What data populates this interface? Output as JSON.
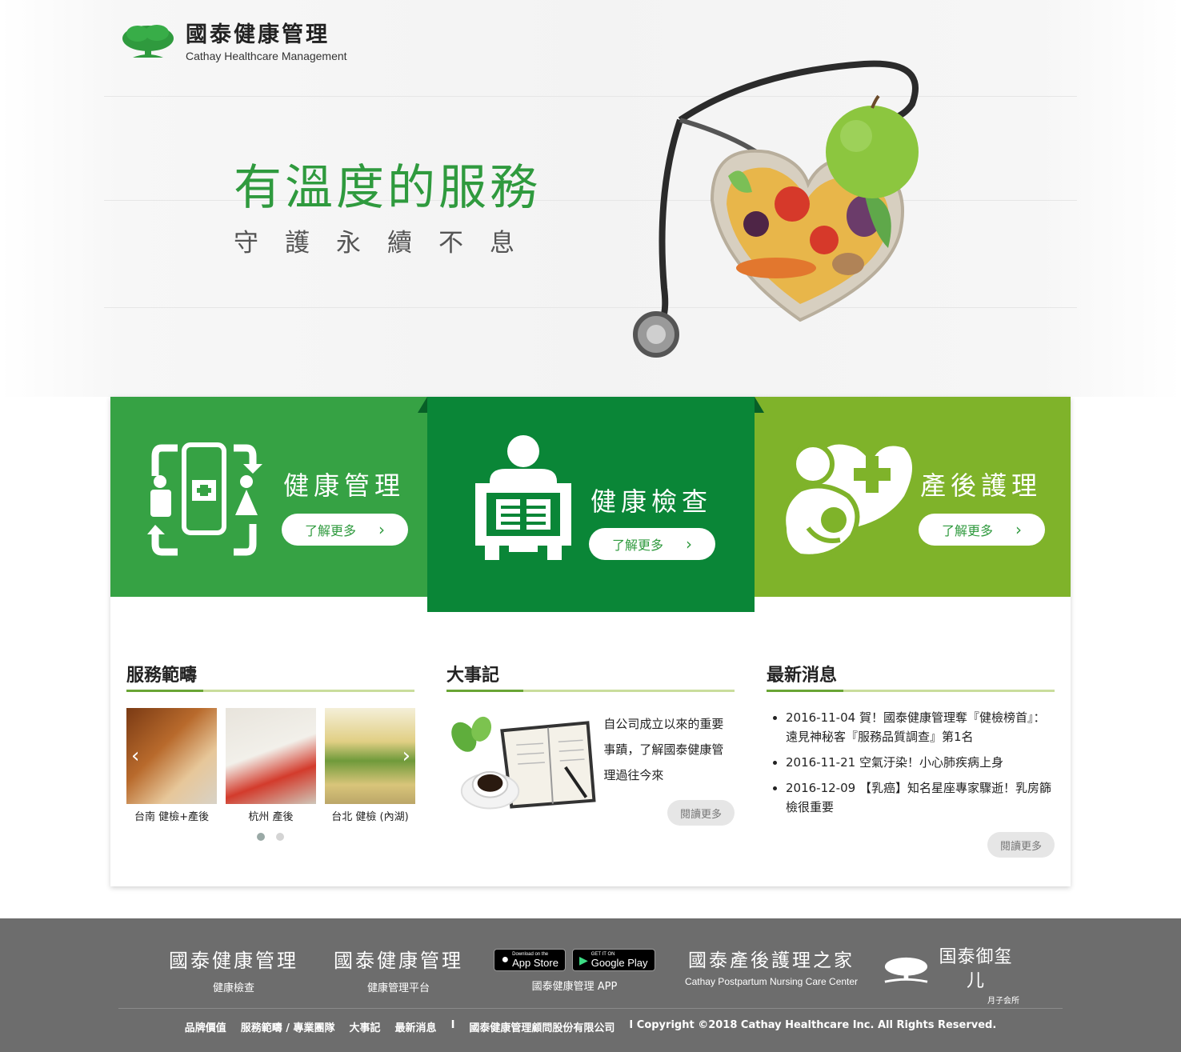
{
  "brand": {
    "name_zh": "國泰健康管理",
    "name_en": "Cathay Healthcare Management",
    "color_green": "#2f9a3e"
  },
  "hero": {
    "headline": "有溫度的服務",
    "subline": "守護永續不息"
  },
  "panels": [
    {
      "title": "健康管理",
      "more_label": "了解更多",
      "icon": "phone-health-icon",
      "color": "#36a244"
    },
    {
      "title": "健康檢查",
      "more_label": "了解更多",
      "icon": "xray-icon",
      "color": "#0a8637"
    },
    {
      "title": "產後護理",
      "more_label": "了解更多",
      "icon": "mother-baby-icon",
      "color": "#7fb32a"
    }
  ],
  "services": {
    "heading": "服務範疇",
    "items": [
      {
        "caption": "台南 健檢+產後"
      },
      {
        "caption": "杭州 產後"
      },
      {
        "caption": "台北 健檢 (內湖)"
      }
    ]
  },
  "events": {
    "heading": "大事記",
    "description": "自公司成立以來的重要事蹟，了解國泰健康管理過往今來",
    "read_more": "閱讀更多"
  },
  "news": {
    "heading": "最新消息",
    "items": [
      "2016-11-04 賀！國泰健康管理奪『健檢榜首』：遠見神秘客『服務品質調查』第1名",
      "2016-11-21 空氣汙染！小心肺疾病上身",
      "2016-12-09 【乳癌】知名星座專家驟逝！乳房篩檢很重要"
    ],
    "read_more": "閱讀更多"
  },
  "footer": {
    "brands": [
      {
        "title": "國泰健康管理",
        "sub": "健康檢查"
      },
      {
        "title": "國泰健康管理",
        "sub": "健康管理平台"
      },
      {
        "title": "國泰產後護理之家",
        "sub": "Cathay Postpartum Nursing Care Center"
      },
      {
        "title": "国泰御玺儿",
        "sub": "月子会所"
      }
    ],
    "app": {
      "appstore_small": "Download on the",
      "appstore_big": "App Store",
      "googleplay_small": "GET IT ON",
      "googleplay_big": "Google Play",
      "caption": "國泰健康管理 APP"
    },
    "links": [
      "品牌價值",
      "服務範疇 / 專業團隊",
      "大事記",
      "最新消息",
      "I",
      "國泰健康管理顧問股份有限公司",
      "I Copyright ©2018 Cathay Healthcare Inc. All Rights Reserved."
    ]
  }
}
